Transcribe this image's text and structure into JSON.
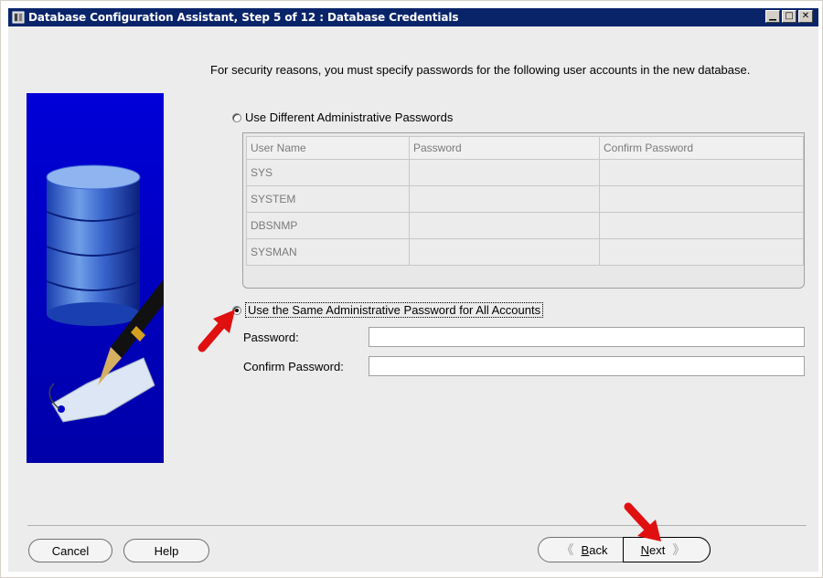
{
  "window": {
    "title": "Database Configuration Assistant, Step 5 of 12 : Database Credentials",
    "minimize": "▁",
    "maximize": "□",
    "close": "✕"
  },
  "intro_text": "For security reasons, you must specify passwords for the following user accounts in the new database.",
  "options": {
    "different": "Use Different Administrative Passwords",
    "same": "Use the Same Administrative Password for All Accounts",
    "selected": "same"
  },
  "accounts_table": {
    "headers": [
      "User Name",
      "Password",
      "Confirm Password"
    ],
    "rows": [
      [
        "SYS",
        "",
        ""
      ],
      [
        "SYSTEM",
        "",
        ""
      ],
      [
        "DBSNMP",
        "",
        ""
      ],
      [
        "SYSMAN",
        "",
        ""
      ]
    ]
  },
  "fields": {
    "password_label": "Password:",
    "password_value": "",
    "confirm_label": "Confirm Password:",
    "confirm_value": ""
  },
  "buttons": {
    "cancel": "Cancel",
    "help": "Help",
    "back_prefix": "B",
    "back_rest": "ack",
    "next_prefix": "N",
    "next_rest": "ext"
  },
  "colors": {
    "title_bar": "#0a246a",
    "art_background": "#0000c8",
    "annotation_arrow": "#e01010"
  },
  "icons": [
    "window-app-icon",
    "database-cylinder-icon",
    "fountain-pen-icon",
    "tag-icon",
    "annotation-arrow-icon"
  ]
}
